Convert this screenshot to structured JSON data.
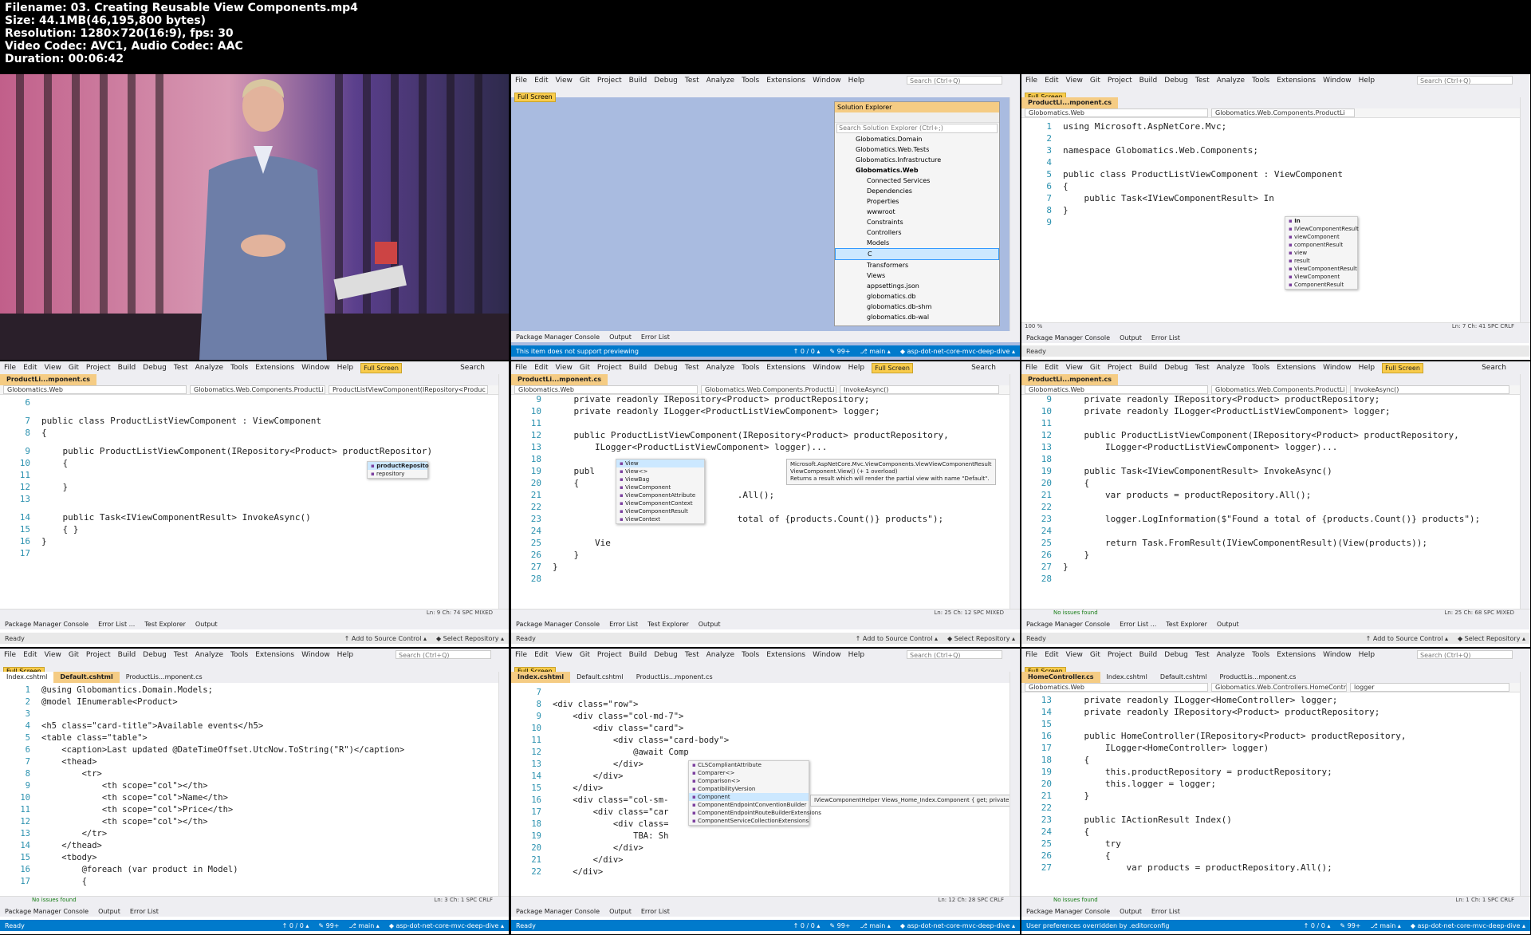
{
  "file_info": {
    "filename": "Filename: 03. Creating Reusable View Components.mp4",
    "size": "Size: 44.1MB(46,195,800 bytes)",
    "resolution": "Resolution: 1280×720(16:9), fps: 30",
    "codec": "Video Codec: AVC1, Audio Codec: AAC",
    "duration": "Duration: 00:06:42"
  },
  "menu": [
    "File",
    "Edit",
    "View",
    "Git",
    "Project",
    "Build",
    "Debug",
    "Test",
    "Analyze",
    "Tools",
    "Extensions",
    "Window",
    "Help"
  ],
  "full_screen": "Full Screen",
  "search": "Search (Ctrl+Q)",
  "search_short": "Search",
  "frame2": {
    "solution_explorer_title": "Solution Explorer",
    "search_placeholder": "Search Solution Explorer (Ctrl+;)",
    "items": [
      "Globomatics.Domain",
      "Globomatics.Web.Tests",
      "Globomatics.Infrastructure",
      "Globomatics.Web",
      "Connected Services",
      "Dependencies",
      "Properties",
      "wwwroot",
      "Constraints",
      "Controllers",
      "Models",
      "C",
      "Transformers",
      "Views",
      "appsettings.json",
      "globomatics.db",
      "globomatics.db-shm",
      "globomatics.db-wal"
    ],
    "panels": [
      "Package Manager Console",
      "Output",
      "Error List"
    ],
    "status": "This item does not support previewing",
    "status_right": [
      "↑ 0 / 0 ▴",
      "✎ 99+",
      "⎇ main ▴",
      "◆ asp-dot-net-core-mvc-deep-dive ▴"
    ]
  },
  "frame3": {
    "tab": "ProductLi...mponent.cs",
    "nav": [
      "Globomatics.Web",
      "Globomatics.Web.Components.ProductLi"
    ],
    "lines": [
      {
        "n": "1",
        "t": "using Microsoft.AspNetCore.Mvc;"
      },
      {
        "n": "2",
        "t": ""
      },
      {
        "n": "3",
        "t": "namespace Globomatics.Web.Components;"
      },
      {
        "n": "4",
        "t": ""
      },
      {
        "n": "5",
        "t": "public class ProductListViewComponent : ViewComponent"
      },
      {
        "n": "6",
        "t": "{"
      },
      {
        "n": "7",
        "t": "    public Task<IViewComponentResult> In"
      },
      {
        "n": "8",
        "t": "}"
      },
      {
        "n": "9",
        "t": ""
      }
    ],
    "completion": [
      "IViewComponentResult",
      "viewComponent",
      "componentResult",
      "view",
      "result",
      "ViewComponentResult",
      "ViewComponent",
      "ComponentResult"
    ],
    "completion_head": "In",
    "position": "Ln: 7   Ch: 41   SPC   CRLF",
    "zoom": "100 %",
    "panels": [
      "Package Manager Console",
      "Output",
      "Error List"
    ],
    "ready": "Ready"
  },
  "frame4": {
    "tab": "ProductLi...mponent.cs",
    "nav": [
      "Globomatics.Web",
      "Globomatics.Web.Components.ProductLi",
      "ProductListViewComponent(IRepository<Produc"
    ],
    "lines": [
      {
        "n": "6",
        "t": ""
      },
      {
        "n": "7",
        "t": "public class ProductListViewComponent : ViewComponent"
      },
      {
        "n": "8",
        "t": "{"
      },
      {
        "n": "9",
        "t": "    public ProductListViewComponent(IRepository<Product> productRepositor)"
      },
      {
        "n": "10",
        "t": "    {"
      },
      {
        "n": "11",
        "t": ""
      },
      {
        "n": "12",
        "t": "    }"
      },
      {
        "n": "13",
        "t": ""
      },
      {
        "n": "14",
        "t": "    public Task<IViewComponentResult> InvokeAsync()"
      },
      {
        "n": "15",
        "t": "    { }"
      },
      {
        "n": "16",
        "t": "}"
      },
      {
        "n": "17",
        "t": ""
      }
    ],
    "completion": [
      "productReposito",
      "repository"
    ],
    "position": "Ln: 9   Ch: 74   SPC   MIXED",
    "panels": [
      "Package Manager Console",
      "Error List ...",
      "Test Explorer",
      "Output"
    ],
    "ready": "Ready",
    "source_control": "↑ Add to Source Control ▴",
    "repo": "◆ Select Repository ▴"
  },
  "frame5": {
    "tab": "ProductLi...mponent.cs",
    "nav": [
      "Globomatics.Web",
      "Globomatics.Web.Components.ProductLi",
      "InvokeAsync()"
    ],
    "lines": [
      {
        "n": "9",
        "t": "    private readonly IRepository<Product> productRepository;"
      },
      {
        "n": "10",
        "t": "    private readonly ILogger<ProductListViewComponent> logger;"
      },
      {
        "n": "11",
        "t": ""
      },
      {
        "n": "12",
        "t": "    public ProductListViewComponent(IRepository<Product> productRepository,"
      },
      {
        "n": "13",
        "t": "        ILogger<ProductListViewComponent> logger)..."
      },
      {
        "n": "18",
        "t": ""
      },
      {
        "n": "19",
        "t": "    publ"
      },
      {
        "n": "20",
        "t": "    {"
      },
      {
        "n": "21",
        "t": "                                   .All();"
      },
      {
        "n": "22",
        "t": ""
      },
      {
        "n": "23",
        "t": "                                   total of {products.Count()} products\");"
      },
      {
        "n": "24",
        "t": ""
      },
      {
        "n": "25",
        "t": "        Vie"
      },
      {
        "n": "26",
        "t": "    }"
      },
      {
        "n": "27",
        "t": "}"
      },
      {
        "n": "28",
        "t": ""
      }
    ],
    "completion": [
      "View",
      "View<>",
      "ViewBag",
      "ViewComponent",
      "ViewComponentAttribute",
      "ViewComponentContext",
      "ViewComponentResult",
      "ViewContext"
    ],
    "tooltip": [
      "Microsoft.AspNetCore.Mvc.ViewComponents.ViewViewComponentResult",
      "ViewComponent.View() (+ 1 overload)",
      "Returns a result which will render the partial view with name \"Default\"."
    ],
    "position": "Ln: 25   Ch: 12   SPC   MIXED",
    "panels": [
      "Package Manager Console",
      "Error List",
      "Test Explorer",
      "Output"
    ],
    "ready": "Ready",
    "source_control": "↑ Add to Source Control ▴",
    "repo": "◆ Select Repository ▴"
  },
  "frame6": {
    "tab": "ProductLi...mponent.cs",
    "nav": [
      "Globomatics.Web",
      "Globomatics.Web.Components.ProductLi",
      "InvokeAsync()"
    ],
    "lines": [
      {
        "n": "9",
        "t": "    private readonly IRepository<Product> productRepository;"
      },
      {
        "n": "10",
        "t": "    private readonly ILogger<ProductListViewComponent> logger;"
      },
      {
        "n": "11",
        "t": ""
      },
      {
        "n": "12",
        "t": "    public ProductListViewComponent(IRepository<Product> productRepository,"
      },
      {
        "n": "13",
        "t": "        ILogger<ProductListViewComponent> logger)..."
      },
      {
        "n": "18",
        "t": ""
      },
      {
        "n": "19",
        "t": "    public Task<IViewComponentResult> InvokeAsync()"
      },
      {
        "n": "20",
        "t": "    {"
      },
      {
        "n": "21",
        "t": "        var products = productRepository.All();"
      },
      {
        "n": "22",
        "t": ""
      },
      {
        "n": "23",
        "t": "        logger.LogInformation($\"Found a total of {products.Count()} products\");"
      },
      {
        "n": "24",
        "t": ""
      },
      {
        "n": "25",
        "t": "        return Task.FromResult(IViewComponentResult)(View(products));"
      },
      {
        "n": "26",
        "t": "    }"
      },
      {
        "n": "27",
        "t": "}"
      },
      {
        "n": "28",
        "t": ""
      }
    ],
    "issues": "No issues found",
    "position": "Ln: 25   Ch: 68   SPC   MIXED",
    "panels": [
      "Package Manager Console",
      "Error List ...",
      "Test Explorer",
      "Output"
    ],
    "ready": "Ready",
    "source_control": "↑ Add to Source Control ▴",
    "repo": "◆ Select Repository ▴"
  },
  "frame7": {
    "tabs": [
      "Index.cshtml",
      "Default.cshtml",
      "ProductLis...mponent.cs"
    ],
    "lines": [
      {
        "n": "1",
        "t": "@using Globomantics.Domain.Models;"
      },
      {
        "n": "2",
        "t": "@model IEnumerable<Product>"
      },
      {
        "n": "3",
        "t": ""
      },
      {
        "n": "4",
        "t": "<h5 class=\"card-title\">Available events</h5>"
      },
      {
        "n": "5",
        "t": "<table class=\"table\">"
      },
      {
        "n": "6",
        "t": "    <caption>Last updated @DateTimeOffset.UtcNow.ToString(\"R\")</caption>"
      },
      {
        "n": "7",
        "t": "    <thead>"
      },
      {
        "n": "8",
        "t": "        <tr>"
      },
      {
        "n": "9",
        "t": "            <th scope=\"col\"></th>"
      },
      {
        "n": "10",
        "t": "            <th scope=\"col\">Name</th>"
      },
      {
        "n": "11",
        "t": "            <th scope=\"col\">Price</th>"
      },
      {
        "n": "12",
        "t": "            <th scope=\"col\"></th>"
      },
      {
        "n": "13",
        "t": "        </tr>"
      },
      {
        "n": "14",
        "t": "    </thead>"
      },
      {
        "n": "15",
        "t": "    <tbody>"
      },
      {
        "n": "16",
        "t": "        @foreach (var product in Model)"
      },
      {
        "n": "17",
        "t": "        {"
      }
    ],
    "issues": "No issues found",
    "position": "Ln: 3   Ch: 1   SPC   CRLF",
    "panels": [
      "Package Manager Console",
      "Output",
      "Error List"
    ],
    "ready": "Ready",
    "status_right": [
      "↑ 0 / 0 ▴",
      "✎ 99+",
      "⎇ main ▴",
      "◆ asp-dot-net-core-mvc-deep-dive ▴"
    ]
  },
  "frame8": {
    "tabs": [
      "Index.cshtml",
      "Default.cshtml",
      "ProductLis...mponent.cs"
    ],
    "lines": [
      {
        "n": "7",
        "t": ""
      },
      {
        "n": "8",
        "t": "<div class=\"row\">"
      },
      {
        "n": "9",
        "t": "    <div class=\"col-md-7\">"
      },
      {
        "n": "10",
        "t": "        <div class=\"card\">"
      },
      {
        "n": "11",
        "t": "            <div class=\"card-body\">"
      },
      {
        "n": "12",
        "t": "                @await Comp"
      },
      {
        "n": "13",
        "t": "            </div>"
      },
      {
        "n": "14",
        "t": "        </div>"
      },
      {
        "n": "15",
        "t": "    </div>"
      },
      {
        "n": "16",
        "t": "    <div class=\"col-sm-"
      },
      {
        "n": "17",
        "t": "        <div class=\"car"
      },
      {
        "n": "18",
        "t": "            <div class="
      },
      {
        "n": "19",
        "t": "                TBA: Sh"
      },
      {
        "n": "20",
        "t": "            </div>"
      },
      {
        "n": "21",
        "t": "        </div>"
      },
      {
        "n": "22",
        "t": "    </div>"
      }
    ],
    "completion": [
      "CLSCompliantAttribute",
      "Comparer<>",
      "Comparison<>",
      "CompatibilityVersion",
      "Component",
      "ComponentEndpointConventionBuilder",
      "ComponentEndpointRouteBuilderExtensions",
      "ComponentServiceCollectionExtensions"
    ],
    "tooltip": "IViewComponentHelper Views_Home_Index.Component { get; private set; }",
    "position": "Ln: 12   Ch: 28   SPC   CRLF",
    "panels": [
      "Package Manager Console",
      "Output",
      "Error List"
    ],
    "ready": "Ready",
    "status_right": [
      "↑ 0 / 0 ▴",
      "✎ 99+",
      "⎇ main ▴",
      "◆ asp-dot-net-core-mvc-deep-dive ▴"
    ]
  },
  "frame9": {
    "tabs": [
      "HomeController.cs",
      "Index.cshtml",
      "Default.cshtml",
      "ProductLis...mponent.cs"
    ],
    "nav": [
      "Globomatics.Web",
      "Globomatics.Web.Controllers.HomeContr",
      "logger"
    ],
    "lines": [
      {
        "n": "13",
        "t": "    private readonly ILogger<HomeController> logger;"
      },
      {
        "n": "14",
        "t": "    private readonly IRepository<Product> productRepository;"
      },
      {
        "n": "15",
        "t": ""
      },
      {
        "n": "16",
        "t": "    public HomeController(IRepository<Product> productRepository,"
      },
      {
        "n": "17",
        "t": "        ILogger<HomeController> logger)"
      },
      {
        "n": "18",
        "t": "    {"
      },
      {
        "n": "19",
        "t": "        this.productRepository = productRepository;"
      },
      {
        "n": "20",
        "t": "        this.logger = logger;"
      },
      {
        "n": "21",
        "t": "    }"
      },
      {
        "n": "22",
        "t": ""
      },
      {
        "n": "23",
        "t": "    public IActionResult Index()"
      },
      {
        "n": "24",
        "t": "    {"
      },
      {
        "n": "25",
        "t": "        try"
      },
      {
        "n": "26",
        "t": "        {"
      },
      {
        "n": "27",
        "t": "            var products = productRepository.All();"
      }
    ],
    "issues": "No issues found",
    "position": "Ln: 1   Ch: 1   SPC   CRLF",
    "panels": [
      "Package Manager Console",
      "Output",
      "Error List"
    ],
    "ready": "User preferences overridden by .editorconfig",
    "status_right": [
      "↑ 0 / 0 ▴",
      "✎ 99+",
      "⎇ main ▴",
      "◆ asp-dot-net-core-mvc-deep-dive ▴"
    ]
  }
}
